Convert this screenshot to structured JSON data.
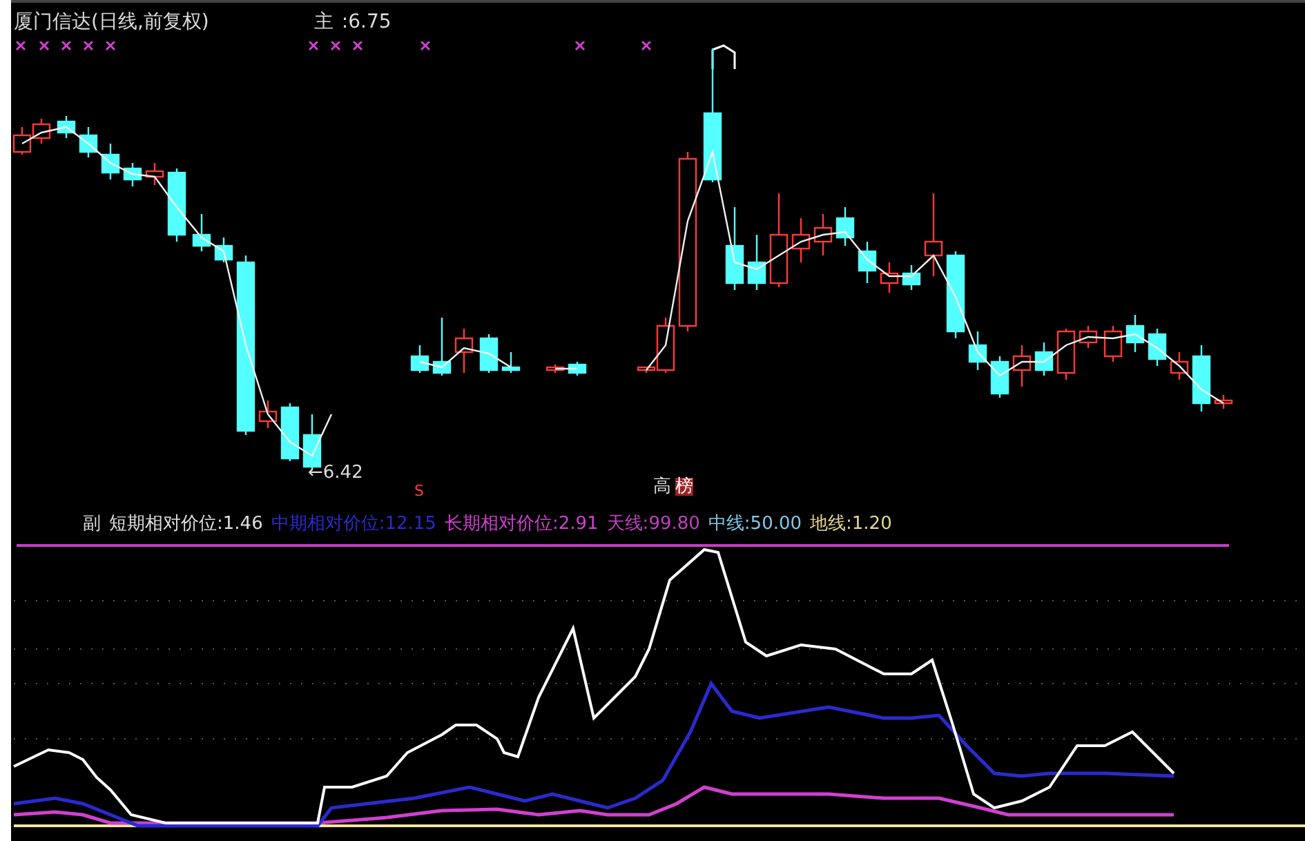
{
  "header": {
    "title": "厦门信达(日线,前复权)",
    "main_label": "主",
    "main_value": ":6.75"
  },
  "annotations": {
    "low_price": "←6.42",
    "signal_s": "S",
    "signal_high": "高",
    "signal_tag": "榜"
  },
  "legend": {
    "panel_label": "副",
    "indicators": [
      {
        "label": "短期相对价位:",
        "value": "1.46",
        "color": "#e0e0e0"
      },
      {
        "label": "中期相对价位:",
        "value": "12.15",
        "color": "#2a2ad0"
      },
      {
        "label": "长期相对价位:",
        "value": "2.91",
        "color": "#d040d0"
      },
      {
        "label": "天线:",
        "value": "99.80",
        "color": "#c040c0"
      },
      {
        "label": "中线:",
        "value": "50.00",
        "color": "#80c8e8"
      },
      {
        "label": "地线:",
        "value": "1.20",
        "color": "#e8d890"
      }
    ]
  }
}
